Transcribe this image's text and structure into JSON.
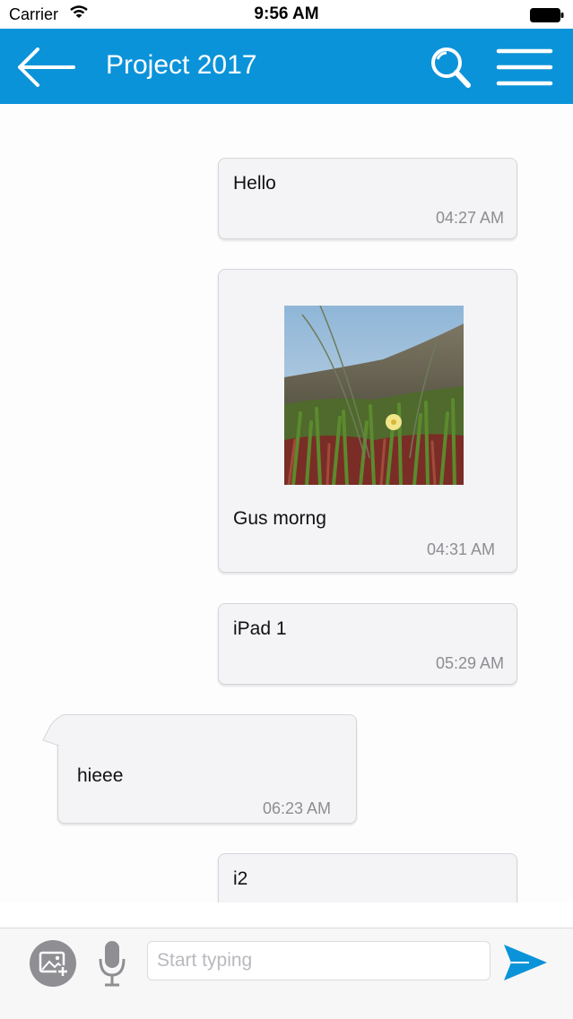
{
  "status_bar": {
    "carrier": "Carrier",
    "time": "9:56 AM",
    "icons": [
      "wifi-icon",
      "battery-icon"
    ]
  },
  "header": {
    "title": "Project 2017",
    "background_color": "#0b93d9",
    "icons": [
      "back-arrow-icon",
      "search-icon",
      "menu-icon"
    ]
  },
  "messages": [
    {
      "direction": "outgoing",
      "type": "text",
      "text": "Hello",
      "time": "04:27 AM"
    },
    {
      "direction": "outgoing",
      "type": "image",
      "text": "Gus morng",
      "time": "04:31 AM"
    },
    {
      "direction": "outgoing",
      "type": "text",
      "text": "iPad 1",
      "time": "05:29 AM"
    },
    {
      "direction": "incoming",
      "type": "text",
      "text": "hieee",
      "time": "06:23 AM"
    },
    {
      "direction": "outgoing",
      "type": "text",
      "text": "i2",
      "time": ""
    }
  ],
  "composer": {
    "placeholder": "Start typing",
    "value": "",
    "icons": [
      "add-image-icon",
      "microphone-icon",
      "send-icon"
    ],
    "send_color": "#0b93d9"
  }
}
